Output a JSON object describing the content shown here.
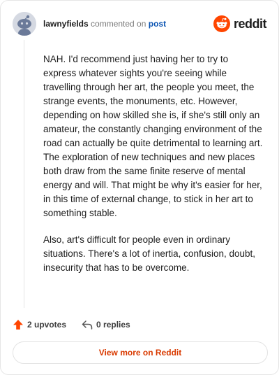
{
  "header": {
    "username": "lawnyfields",
    "verb": "commented on",
    "post_link": "post",
    "brand": "reddit"
  },
  "comment": {
    "paragraphs": [
      "NAH. I'd recommend just having her to try to express whatever sights you're seeing while travelling through her art, the people you meet, the strange events, the monuments, etc. However, depending on how skilled she is, if she's still only an amateur, the constantly changing environment of the road can actually be quite detrimental to learning art. The exploration of new techniques and new places both draw from the same finite reserve of mental energy and will. That might be why it's easier for her, in this time of external change, to stick in her art to something stable.",
      "Also, art's difficult for people even in ordinary situations. There's a lot of inertia, confusion, doubt, insecurity that has to be overcome."
    ]
  },
  "actions": {
    "upvotes": "2 upvotes",
    "replies": "0 replies"
  },
  "view_more": "View more on Reddit",
  "colors": {
    "brand_orange": "#ff4500",
    "link_blue": "#0a54b3",
    "cta_orange": "#d93a00"
  }
}
